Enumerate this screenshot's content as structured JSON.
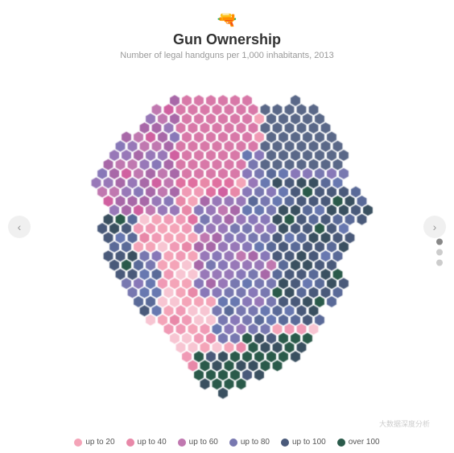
{
  "header": {
    "icon": "🔫",
    "title": "Gun Ownership",
    "subtitle": "Number of legal handguns per 1,000 inhabitants, 2013"
  },
  "nav": {
    "left_label": "‹",
    "right_label": "›"
  },
  "legend": [
    {
      "label": "up to 20",
      "color": "#f4a4b8"
    },
    {
      "label": "up to 40",
      "color": "#e888a8"
    },
    {
      "label": "up to 60",
      "color": "#c078b0"
    },
    {
      "label": "up to 80",
      "color": "#7878b0"
    },
    {
      "label": "up to 100",
      "color": "#4a5a7a"
    },
    {
      "label": "over 100",
      "color": "#2a5a4a"
    }
  ],
  "dots_nav": [
    {
      "active": false
    },
    {
      "active": false
    },
    {
      "active": true
    },
    {
      "active": false
    }
  ],
  "watermark": "大数据深度分析"
}
